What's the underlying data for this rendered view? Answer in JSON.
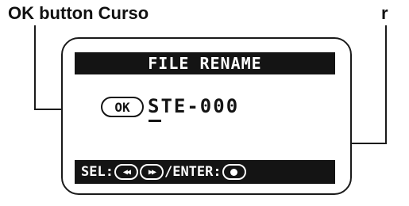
{
  "callouts": {
    "left_label": "OK button Curso",
    "right_label": "r"
  },
  "screen": {
    "title": "FILE RENAME",
    "ok_badge": "OK",
    "filename_cursor_char": "S",
    "filename_rest": "TE-000",
    "status": {
      "sel_label": "SEL:",
      "separator": "/",
      "enter_label": "ENTER:"
    }
  },
  "icons": {
    "skip_back": "rewind-icon",
    "skip_forward": "fast-forward-icon",
    "enter": "record-dot-icon"
  },
  "colors": {
    "lcd_dark": "#141414",
    "background": "#ffffff"
  }
}
